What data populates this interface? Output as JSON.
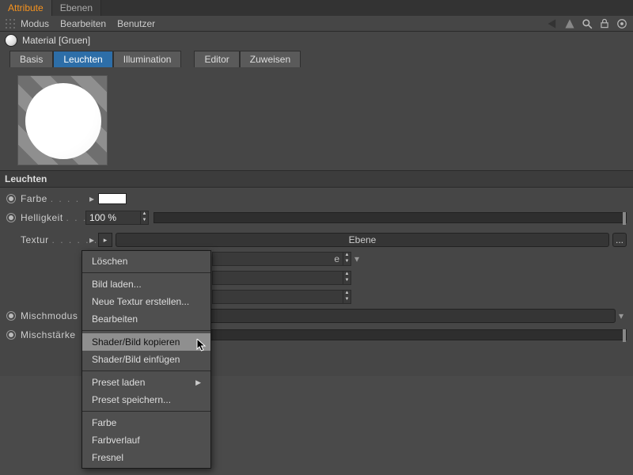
{
  "top_tabs": {
    "attribute": "Attribute",
    "ebenen": "Ebenen"
  },
  "toolbar": {
    "modus": "Modus",
    "bearbeiten": "Bearbeiten",
    "benutzer": "Benutzer"
  },
  "material": {
    "title": "Material [Gruen]"
  },
  "channel_tabs": {
    "basis": "Basis",
    "leuchten": "Leuchten",
    "illumination": "Illumination",
    "editor": "Editor",
    "zuweisen": "Zuweisen"
  },
  "section": {
    "leuchten": "Leuchten"
  },
  "props": {
    "farbe": "Farbe",
    "helligkeit": "Helligkeit",
    "helligkeit_value": "100 %",
    "textur": "Textur",
    "textur_value": "Ebene",
    "mischmodus": "Mischmodus",
    "mischstaerke": "Mischstärke",
    "ellipsis": "..."
  },
  "hidden_dropdown_suffix": "e",
  "context_menu": {
    "loeschen": "Löschen",
    "bild_laden": "Bild laden...",
    "neue_textur": "Neue Textur erstellen...",
    "bearbeiten": "Bearbeiten",
    "shader_kopieren": "Shader/Bild kopieren",
    "shader_einfuegen": "Shader/Bild einfügen",
    "preset_laden": "Preset laden",
    "preset_speichern": "Preset speichern...",
    "farbe": "Farbe",
    "farbverlauf": "Farbverlauf",
    "fresnel": "Fresnel"
  }
}
